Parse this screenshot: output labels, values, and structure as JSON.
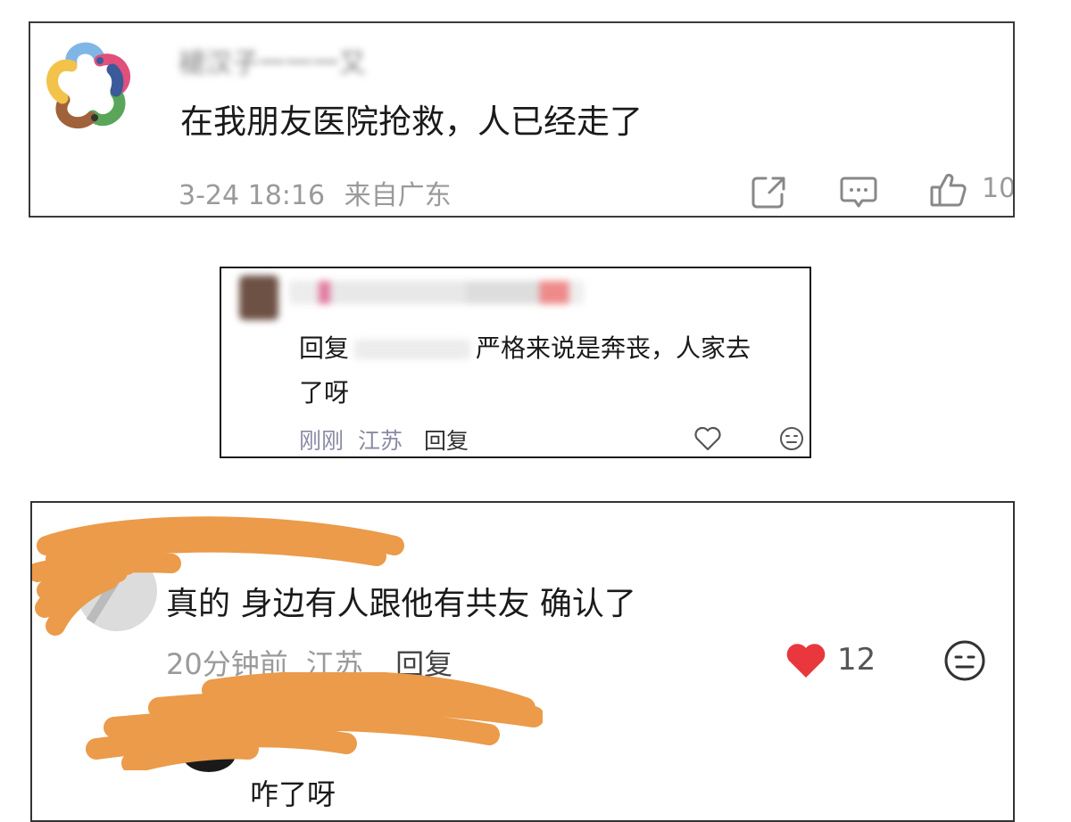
{
  "comment1": {
    "username": "褪汉子一一一又",
    "text": "在我朋友医院抢救，人已经走了",
    "timestamp": "3-24 18:16",
    "location": "来自广东",
    "like_count": "10",
    "icons": [
      "share-icon",
      "comment-icon",
      "thumbs-up-icon"
    ]
  },
  "comment2": {
    "reply_prefix": "回复",
    "text_line1": "严格来说是奔丧，人家去",
    "text_line2": "了呀",
    "timestamp": "刚刚",
    "location": "江苏",
    "reply_label": "回复",
    "icons": [
      "heart-outline-icon",
      "emoji-icon"
    ]
  },
  "comment3": {
    "text": "真的 身边有人跟他有共友 确认了",
    "timestamp": "20分钟前",
    "location": "江苏",
    "reply_label": "回复",
    "like_count": "12",
    "icons": [
      "heart-filled-icon",
      "emoji-icon"
    ],
    "reply": {
      "text": "咋了呀"
    }
  },
  "colors": {
    "redaction_orange": "#eb9b4a",
    "heart_red": "#e8383d",
    "meta_gray": "#9a9a9a"
  }
}
